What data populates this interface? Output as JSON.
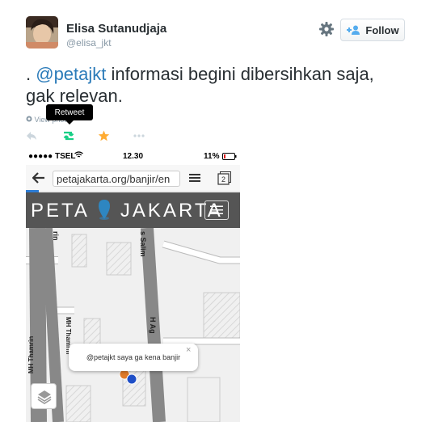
{
  "user": {
    "name": "Elisa Sutanudjaja",
    "handle": "@elisa_jkt"
  },
  "follow_label": "Follow",
  "tweet": {
    "prefix": ". ",
    "mention": "@petajkt",
    "text_line1": " informasi begini dibersihkan saja,",
    "text_line2": "gak relevan."
  },
  "tooltip": "Retweet",
  "view_photo_label": "View photo",
  "icons": [
    "avatar",
    "gear-icon",
    "follow-user-icon",
    "reply-icon",
    "retweet-icon",
    "favorite-star-icon",
    "more-icon"
  ],
  "colors": {
    "mention": "#2b7bb9",
    "retweet_active": "#19cf86",
    "favorite_active": "#ffac33"
  },
  "phone": {
    "carrier": "●●●●● TSEL",
    "time": "12.30",
    "battery": "11%",
    "url": "petajakarta.org/banjir/en",
    "brand_left": "PETA",
    "brand_right": "JAKARTA",
    "street_labels": [
      "rin",
      "s Salim",
      "MH Thamrin",
      "MH Thamrin",
      "H Ag",
      "n"
    ],
    "popup_text": "@petajkt saya ga kena banjir",
    "popup_close": "×"
  }
}
